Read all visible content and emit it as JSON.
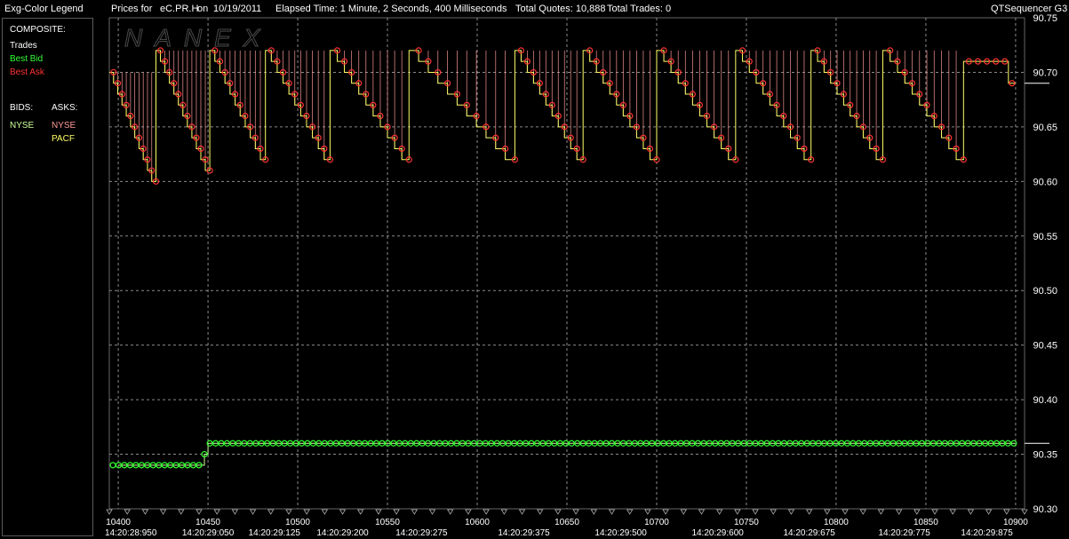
{
  "header": {
    "legend_title": "Exg-Color Legend",
    "prices_label": "Prices for",
    "symbol": "eC.PR.H",
    "on_label": "on",
    "date": "10/19/2011",
    "elapsed": "Elapsed Time: 1 Minute, 2 Seconds, 400 Milliseconds",
    "total_quotes": "Total Quotes: 10,888",
    "total_trades": "Total Trades: 0",
    "app_name": "QTSequencer G3",
    "watermark": "NANEX"
  },
  "legend": {
    "composite_label": "COMPOSITE:",
    "trades": "Trades",
    "best_bid": "Best Bid",
    "best_ask": "Best Ask",
    "bids_label": "BIDS:",
    "asks_label": "ASKS:",
    "bid_exchanges": [
      "NYSE"
    ],
    "ask_exchanges": [
      "NYSE",
      "PACF"
    ]
  },
  "colors": {
    "background": "#000000",
    "grid": "#8a8a8a",
    "trades": "#ffffff",
    "best_bid": "#33ff33",
    "best_ask": "#ff3333",
    "nyse_bid": "#ccff99",
    "nyse_ask": "#ff9999",
    "pacf_ask": "#ffff66"
  },
  "chart_data": {
    "type": "line",
    "title": "Prices for eC.PR.H on 10/19/2011",
    "ylim": [
      90.3,
      90.75
    ],
    "y_ticks": [
      "90.75",
      "90.70",
      "90.65",
      "90.60",
      "90.55",
      "90.50",
      "90.45",
      "90.40",
      "90.35",
      "90.30"
    ],
    "xlim": [
      10395,
      10905
    ],
    "x_ticks": [
      10400,
      10450,
      10500,
      10550,
      10600,
      10650,
      10700,
      10750,
      10800,
      10850,
      10900
    ],
    "x_tick_labels": [
      "10400",
      "10450",
      "10500",
      "10550",
      "10600",
      "10650",
      "10700",
      "10750",
      "10800",
      "10850",
      "10900"
    ],
    "time_labels": [
      "14:20:28:950",
      "14:20:29:050",
      "14:20:29:125",
      "14:20:29:200",
      "14:20:29:275",
      "14:20:29:375",
      "14:20:29:500",
      "14:20:29:600",
      "14:20:29:675",
      "14:20:29:775",
      "14:20:29:875"
    ],
    "time_label_x": [
      10407,
      10450,
      10487,
      10525,
      10569,
      10626,
      10680,
      10734,
      10785,
      10838,
      10884
    ],
    "reference_price": 90.69,
    "series": [
      {
        "name": "Best Bid",
        "legend": "NYSE",
        "x": [
          10400,
          10448,
          10450,
          10900
        ],
        "values": [
          90.34,
          90.35,
          90.36,
          90.36
        ]
      },
      {
        "name": "Best Ask",
        "legend": "NYSE",
        "sawtooth_cycles": [
          {
            "start": 10395,
            "end": 10421,
            "top": 90.7,
            "bottom": 90.6
          },
          {
            "start": 10421,
            "end": 10451,
            "top": 90.72,
            "bottom": 90.61
          },
          {
            "start": 10451,
            "end": 10482,
            "top": 90.72,
            "bottom": 90.62
          },
          {
            "start": 10482,
            "end": 10518,
            "top": 90.72,
            "bottom": 90.62
          },
          {
            "start": 10518,
            "end": 10562,
            "top": 90.72,
            "bottom": 90.62
          },
          {
            "start": 10562,
            "end": 10621,
            "top": 90.72,
            "bottom": 90.62
          },
          {
            "start": 10621,
            "end": 10659,
            "top": 90.72,
            "bottom": 90.62
          },
          {
            "start": 10659,
            "end": 10700,
            "top": 90.72,
            "bottom": 90.62
          },
          {
            "start": 10700,
            "end": 10744,
            "top": 90.72,
            "bottom": 90.62
          },
          {
            "start": 10744,
            "end": 10786,
            "top": 90.72,
            "bottom": 90.62
          },
          {
            "start": 10786,
            "end": 10826,
            "top": 90.72,
            "bottom": 90.62
          },
          {
            "start": 10826,
            "end": 10871,
            "top": 90.72,
            "bottom": 90.62
          }
        ],
        "tail": {
          "start": 10871,
          "end": 10900,
          "level": 90.71,
          "last": 90.69
        }
      }
    ]
  }
}
